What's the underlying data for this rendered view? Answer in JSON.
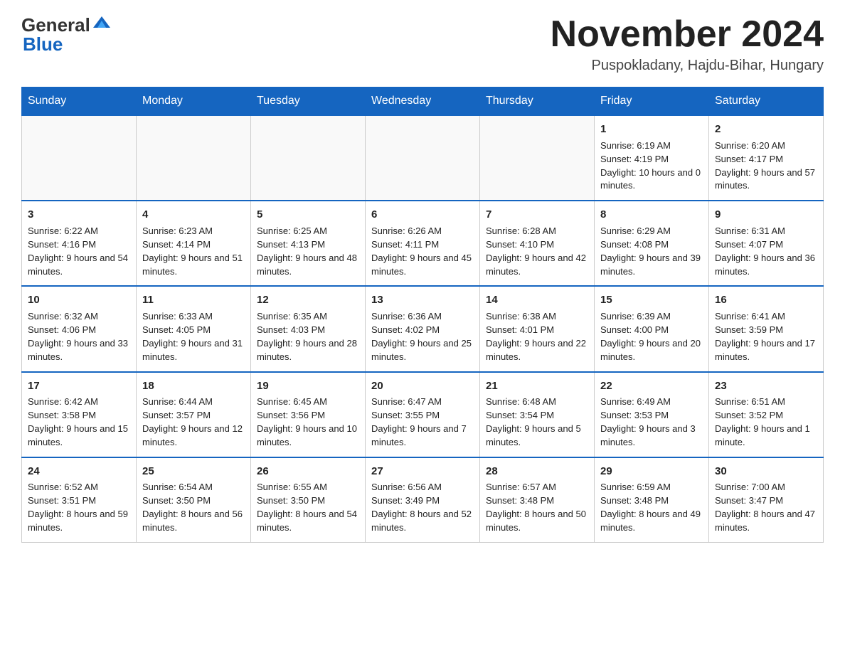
{
  "header": {
    "logo": {
      "general": "General",
      "blue": "Blue"
    },
    "title": "November 2024",
    "location": "Puspokladany, Hajdu-Bihar, Hungary"
  },
  "calendar": {
    "days_of_week": [
      "Sunday",
      "Monday",
      "Tuesday",
      "Wednesday",
      "Thursday",
      "Friday",
      "Saturday"
    ],
    "weeks": [
      [
        {
          "day": "",
          "sunrise": "",
          "sunset": "",
          "daylight": ""
        },
        {
          "day": "",
          "sunrise": "",
          "sunset": "",
          "daylight": ""
        },
        {
          "day": "",
          "sunrise": "",
          "sunset": "",
          "daylight": ""
        },
        {
          "day": "",
          "sunrise": "",
          "sunset": "",
          "daylight": ""
        },
        {
          "day": "",
          "sunrise": "",
          "sunset": "",
          "daylight": ""
        },
        {
          "day": "1",
          "sunrise": "Sunrise: 6:19 AM",
          "sunset": "Sunset: 4:19 PM",
          "daylight": "Daylight: 10 hours and 0 minutes."
        },
        {
          "day": "2",
          "sunrise": "Sunrise: 6:20 AM",
          "sunset": "Sunset: 4:17 PM",
          "daylight": "Daylight: 9 hours and 57 minutes."
        }
      ],
      [
        {
          "day": "3",
          "sunrise": "Sunrise: 6:22 AM",
          "sunset": "Sunset: 4:16 PM",
          "daylight": "Daylight: 9 hours and 54 minutes."
        },
        {
          "day": "4",
          "sunrise": "Sunrise: 6:23 AM",
          "sunset": "Sunset: 4:14 PM",
          "daylight": "Daylight: 9 hours and 51 minutes."
        },
        {
          "day": "5",
          "sunrise": "Sunrise: 6:25 AM",
          "sunset": "Sunset: 4:13 PM",
          "daylight": "Daylight: 9 hours and 48 minutes."
        },
        {
          "day": "6",
          "sunrise": "Sunrise: 6:26 AM",
          "sunset": "Sunset: 4:11 PM",
          "daylight": "Daylight: 9 hours and 45 minutes."
        },
        {
          "day": "7",
          "sunrise": "Sunrise: 6:28 AM",
          "sunset": "Sunset: 4:10 PM",
          "daylight": "Daylight: 9 hours and 42 minutes."
        },
        {
          "day": "8",
          "sunrise": "Sunrise: 6:29 AM",
          "sunset": "Sunset: 4:08 PM",
          "daylight": "Daylight: 9 hours and 39 minutes."
        },
        {
          "day": "9",
          "sunrise": "Sunrise: 6:31 AM",
          "sunset": "Sunset: 4:07 PM",
          "daylight": "Daylight: 9 hours and 36 minutes."
        }
      ],
      [
        {
          "day": "10",
          "sunrise": "Sunrise: 6:32 AM",
          "sunset": "Sunset: 4:06 PM",
          "daylight": "Daylight: 9 hours and 33 minutes."
        },
        {
          "day": "11",
          "sunrise": "Sunrise: 6:33 AM",
          "sunset": "Sunset: 4:05 PM",
          "daylight": "Daylight: 9 hours and 31 minutes."
        },
        {
          "day": "12",
          "sunrise": "Sunrise: 6:35 AM",
          "sunset": "Sunset: 4:03 PM",
          "daylight": "Daylight: 9 hours and 28 minutes."
        },
        {
          "day": "13",
          "sunrise": "Sunrise: 6:36 AM",
          "sunset": "Sunset: 4:02 PM",
          "daylight": "Daylight: 9 hours and 25 minutes."
        },
        {
          "day": "14",
          "sunrise": "Sunrise: 6:38 AM",
          "sunset": "Sunset: 4:01 PM",
          "daylight": "Daylight: 9 hours and 22 minutes."
        },
        {
          "day": "15",
          "sunrise": "Sunrise: 6:39 AM",
          "sunset": "Sunset: 4:00 PM",
          "daylight": "Daylight: 9 hours and 20 minutes."
        },
        {
          "day": "16",
          "sunrise": "Sunrise: 6:41 AM",
          "sunset": "Sunset: 3:59 PM",
          "daylight": "Daylight: 9 hours and 17 minutes."
        }
      ],
      [
        {
          "day": "17",
          "sunrise": "Sunrise: 6:42 AM",
          "sunset": "Sunset: 3:58 PM",
          "daylight": "Daylight: 9 hours and 15 minutes."
        },
        {
          "day": "18",
          "sunrise": "Sunrise: 6:44 AM",
          "sunset": "Sunset: 3:57 PM",
          "daylight": "Daylight: 9 hours and 12 minutes."
        },
        {
          "day": "19",
          "sunrise": "Sunrise: 6:45 AM",
          "sunset": "Sunset: 3:56 PM",
          "daylight": "Daylight: 9 hours and 10 minutes."
        },
        {
          "day": "20",
          "sunrise": "Sunrise: 6:47 AM",
          "sunset": "Sunset: 3:55 PM",
          "daylight": "Daylight: 9 hours and 7 minutes."
        },
        {
          "day": "21",
          "sunrise": "Sunrise: 6:48 AM",
          "sunset": "Sunset: 3:54 PM",
          "daylight": "Daylight: 9 hours and 5 minutes."
        },
        {
          "day": "22",
          "sunrise": "Sunrise: 6:49 AM",
          "sunset": "Sunset: 3:53 PM",
          "daylight": "Daylight: 9 hours and 3 minutes."
        },
        {
          "day": "23",
          "sunrise": "Sunrise: 6:51 AM",
          "sunset": "Sunset: 3:52 PM",
          "daylight": "Daylight: 9 hours and 1 minute."
        }
      ],
      [
        {
          "day": "24",
          "sunrise": "Sunrise: 6:52 AM",
          "sunset": "Sunset: 3:51 PM",
          "daylight": "Daylight: 8 hours and 59 minutes."
        },
        {
          "day": "25",
          "sunrise": "Sunrise: 6:54 AM",
          "sunset": "Sunset: 3:50 PM",
          "daylight": "Daylight: 8 hours and 56 minutes."
        },
        {
          "day": "26",
          "sunrise": "Sunrise: 6:55 AM",
          "sunset": "Sunset: 3:50 PM",
          "daylight": "Daylight: 8 hours and 54 minutes."
        },
        {
          "day": "27",
          "sunrise": "Sunrise: 6:56 AM",
          "sunset": "Sunset: 3:49 PM",
          "daylight": "Daylight: 8 hours and 52 minutes."
        },
        {
          "day": "28",
          "sunrise": "Sunrise: 6:57 AM",
          "sunset": "Sunset: 3:48 PM",
          "daylight": "Daylight: 8 hours and 50 minutes."
        },
        {
          "day": "29",
          "sunrise": "Sunrise: 6:59 AM",
          "sunset": "Sunset: 3:48 PM",
          "daylight": "Daylight: 8 hours and 49 minutes."
        },
        {
          "day": "30",
          "sunrise": "Sunrise: 7:00 AM",
          "sunset": "Sunset: 3:47 PM",
          "daylight": "Daylight: 8 hours and 47 minutes."
        }
      ]
    ]
  }
}
